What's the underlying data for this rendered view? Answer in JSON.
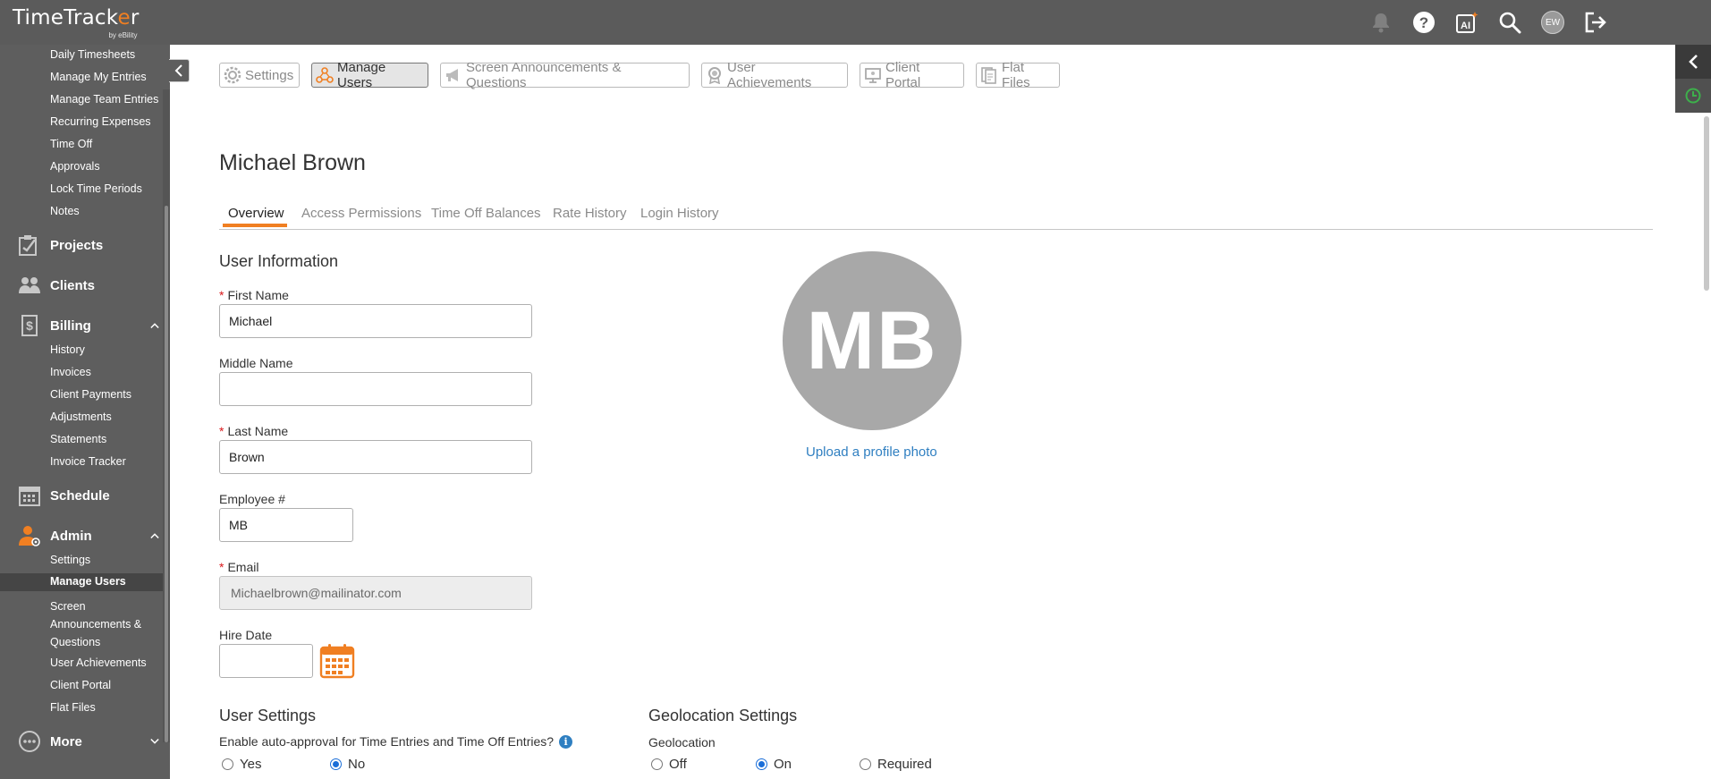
{
  "app": {
    "logo_text_a": "TimeTrack",
    "logo_text_o": "e",
    "logo_text_b": "r",
    "logo_by": "by eBility",
    "user_initials": "EW"
  },
  "sidebar": {
    "time_items": [
      "Daily Timesheets",
      "Manage My Entries",
      "Manage Team Entries",
      "Recurring Expenses",
      "Time Off",
      "Approvals",
      "Lock Time Periods",
      "Notes"
    ],
    "projects": "Projects",
    "clients": "Clients",
    "billing": "Billing",
    "billing_items": [
      "History",
      "Invoices",
      "Client Payments",
      "Adjustments",
      "Statements",
      "Invoice Tracker"
    ],
    "schedule": "Schedule",
    "admin": "Admin",
    "admin_settings": "Settings",
    "admin_manage_users": "Manage Users",
    "admin_screen_1": "Screen",
    "admin_screen_2": "Announcements &",
    "admin_screen_3": "Questions",
    "admin_achievements": "User Achievements",
    "admin_client_portal": "Client Portal",
    "admin_flat_files": "Flat Files",
    "more": "More"
  },
  "toolbar": {
    "settings": "Settings",
    "manage_users": "Manage Users",
    "screen_announcements": "Screen Announcements & Questions",
    "user_achievements": "User Achievements",
    "client_portal": "Client Portal",
    "flat_files": "Flat Files"
  },
  "page": {
    "user_name": "Michael Brown",
    "tabs": [
      "Overview",
      "Access Permissions",
      "Time Off Balances",
      "Rate History",
      "Login History"
    ]
  },
  "user_info": {
    "heading": "User Information",
    "first_name_label": "First Name",
    "first_name_value": "Michael",
    "middle_name_label": "Middle Name",
    "middle_name_value": "",
    "last_name_label": "Last Name",
    "last_name_value": "Brown",
    "employee_label": "Employee #",
    "employee_value": "MB",
    "email_label": "Email",
    "email_value": "Michaelbrown@mailinator.com",
    "hire_date_label": "Hire Date",
    "hire_date_value": "",
    "avatar_initials": "MB",
    "upload_link": "Upload a profile photo"
  },
  "user_settings": {
    "heading": "User Settings",
    "question": "Enable auto-approval for Time Entries and Time Off Entries?",
    "yes": "Yes",
    "no": "No",
    "selected": "No"
  },
  "geolocation": {
    "heading": "Geolocation Settings",
    "label": "Geolocation",
    "off": "Off",
    "on": "On",
    "required": "Required",
    "selected": "On"
  },
  "colors": {
    "topbar": "#5b5b5b",
    "sidebar": "#5e5e5e",
    "accent": "#f07f22",
    "link": "#2f7fc1",
    "required": "#d9181b"
  }
}
